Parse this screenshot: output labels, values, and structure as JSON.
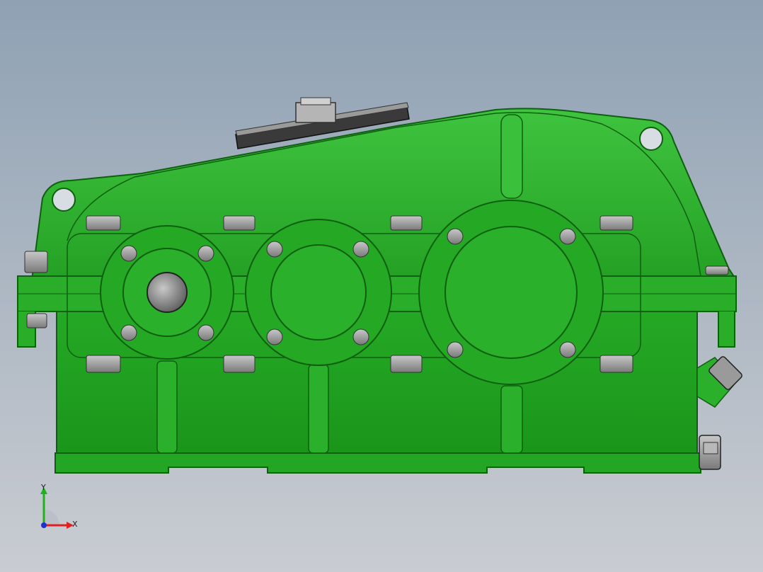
{
  "view": {
    "colors": {
      "housing": "#22a422",
      "housing_dark": "#0f5f10",
      "housing_light": "#4cd24c",
      "bolt": "#9a9a9a",
      "background_top": "#8fa1b4",
      "background_bottom": "#c9ccd2"
    },
    "triad": {
      "x_label": "X",
      "y_label": "Y",
      "x_color": "#e02020",
      "y_color": "#20b020",
      "z_color": "#2030d0"
    }
  }
}
